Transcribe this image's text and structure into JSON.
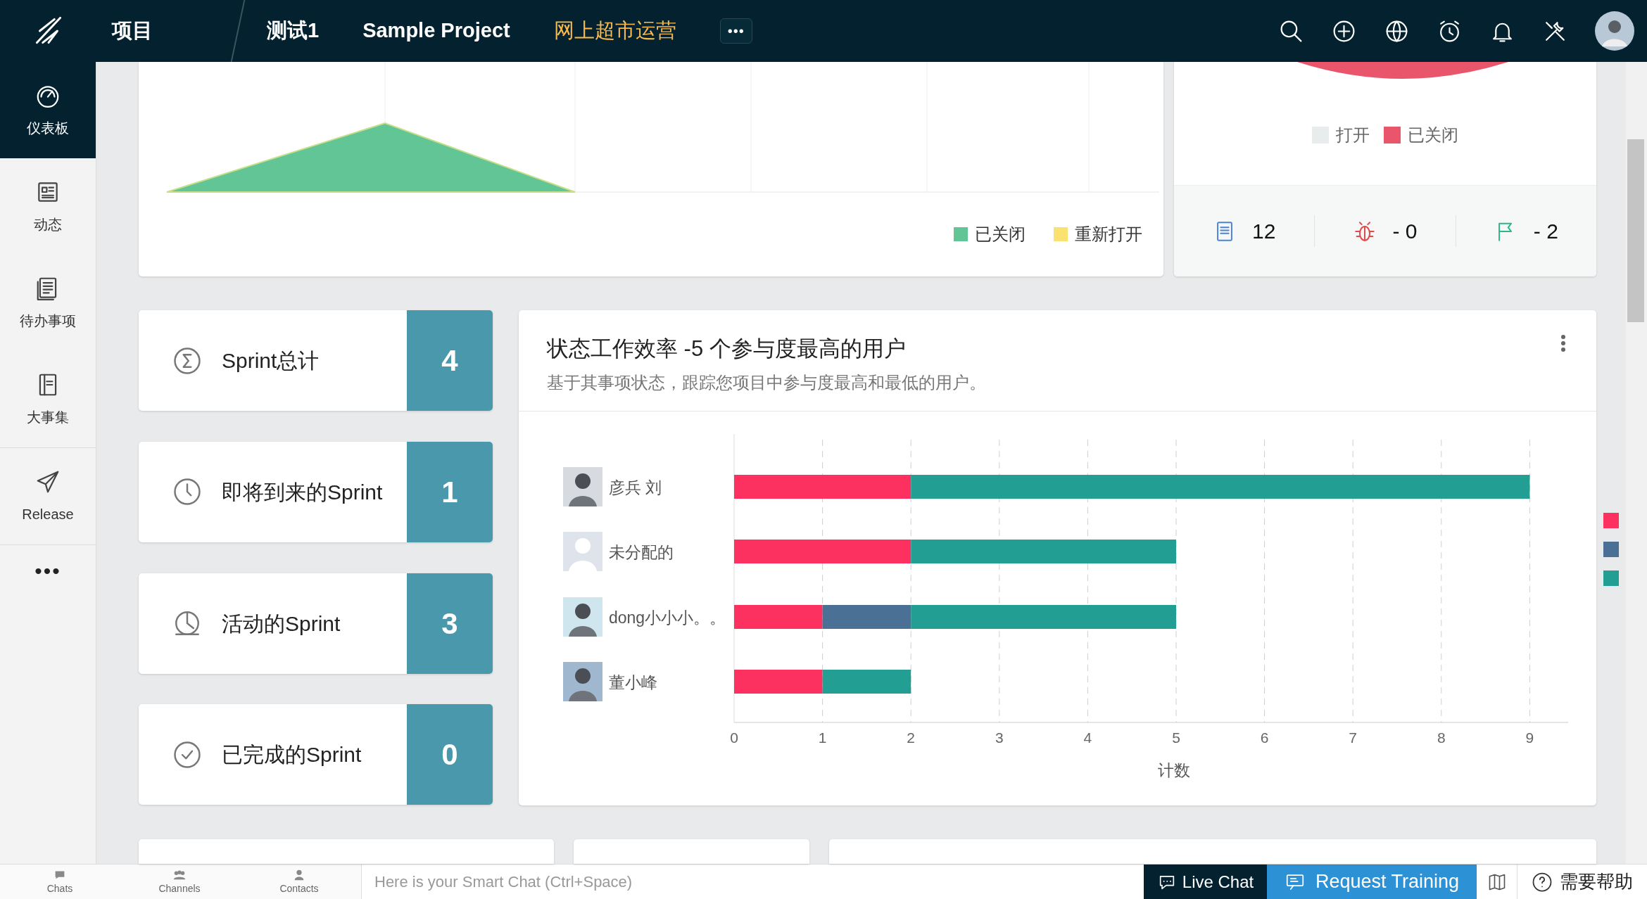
{
  "topbar": {
    "section": "项目",
    "tabs": [
      {
        "label": "测试1",
        "selected": false
      },
      {
        "label": "Sample Project",
        "selected": false
      },
      {
        "label": "网上超市运营",
        "selected": true
      }
    ],
    "more": "•••"
  },
  "sidebar": {
    "items": [
      {
        "label": "仪表板",
        "selected": true
      },
      {
        "label": "动态",
        "selected": false
      },
      {
        "label": "待办事项",
        "selected": false
      },
      {
        "label": "大事集",
        "selected": false
      },
      {
        "label": "Release",
        "selected": false
      }
    ],
    "more": "•••"
  },
  "area_card": {
    "legend": [
      {
        "label": "已关闭",
        "color": "#62c596"
      },
      {
        "label": "重新打开",
        "color": "#f9e270"
      }
    ]
  },
  "pie_card": {
    "legend": [
      {
        "label": "打开",
        "color": "#e9eced"
      },
      {
        "label": "已关闭",
        "color": "#e9556a"
      }
    ],
    "stats": [
      "12",
      "-  0",
      "-  2"
    ]
  },
  "sprint_cards": [
    {
      "label": "Sprint总计",
      "count": "4"
    },
    {
      "label": "即将到来的Sprint",
      "count": "1"
    },
    {
      "label": "活动的Sprint",
      "count": "3"
    },
    {
      "label": "已完成的Sprint",
      "count": "0"
    }
  ],
  "efficiency": {
    "title": "状态工作效率 -5 个参与度最高的用户",
    "subtitle": "基于其事项状态，跟踪您项目中参与度最高和最低的用户。",
    "chart_data": {
      "type": "bar",
      "orientation": "horizontal",
      "stacked": true,
      "grid": true,
      "xlabel": "计数",
      "categories": [
        "彦兵 刘",
        "未分配的",
        "dong小小小。。",
        "董小峰"
      ],
      "xticks": [
        0,
        1,
        2,
        3,
        4,
        5,
        6,
        7,
        8,
        9
      ],
      "xlim": [
        0,
        9
      ],
      "series": [
        {
          "color": "#fc3160",
          "values": [
            2,
            2,
            1,
            1
          ]
        },
        {
          "color": "#4a7096",
          "values": [
            0,
            0,
            1,
            0
          ]
        },
        {
          "color": "#239e93",
          "values": [
            7,
            3,
            3,
            1
          ]
        }
      ]
    }
  },
  "bottom_bar": {
    "tabs": [
      "Chats",
      "Channels",
      "Contacts"
    ],
    "chat_placeholder": "Here is your Smart Chat (Ctrl+Space)",
    "live_chat": "Live Chat",
    "request_training": "Request Training",
    "help": "需要帮助"
  }
}
